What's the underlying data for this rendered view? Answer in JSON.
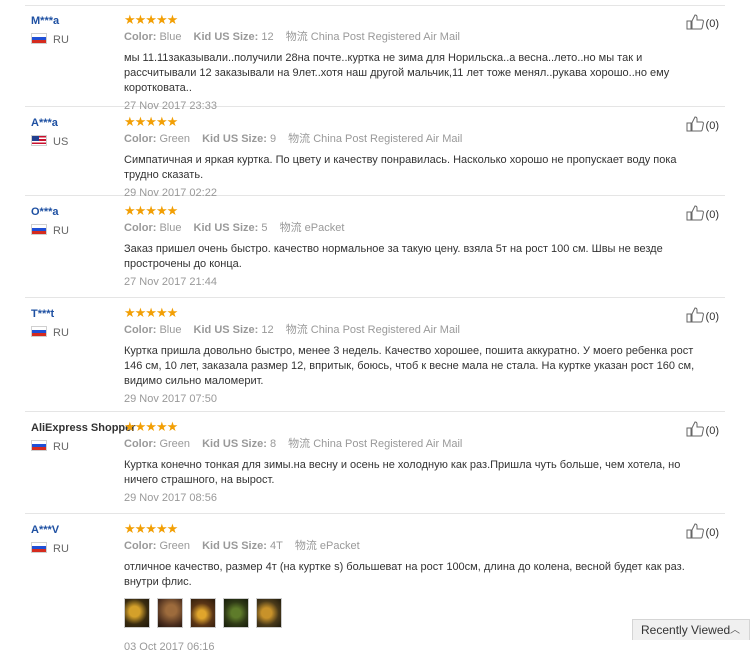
{
  "labels": {
    "color": "Color:",
    "size": "Kid US Size:",
    "helpful_prefix": "(",
    "helpful_suffix": ")"
  },
  "reviews": [
    {
      "user": "M***a",
      "country": "RU",
      "flag": "ru",
      "color": "Blue",
      "size": "12",
      "shipping": "物流 China Post Registered Air Mail",
      "text": "мы 11.11заказывали..получили 28на почте..куртка не зима для Норильска..а весна..лето..но мы так и рассчитывали 12 заказывали на 9лет..хотя наш другой мальчик,11 лет тоже менял..рукава хорошо..но ему коротковата..",
      "date": "27 Nov 2017 23:33",
      "helpful": "0"
    },
    {
      "user": "A***a",
      "country": "US",
      "flag": "us",
      "color": "Green",
      "size": "9",
      "shipping": "物流 China Post Registered Air Mail",
      "text": "Симпатичная и яркая куртка. По цвету и качеству понравилась. Насколько хорошо не пропускает воду пока трудно сказать.",
      "date": "29 Nov 2017 02:22",
      "helpful": "0"
    },
    {
      "user": "O***a",
      "country": "RU",
      "flag": "ru",
      "color": "Blue",
      "size": "5",
      "shipping": "物流 ePacket",
      "text": "Заказ пришел очень быстро. качество нормальное за такую цену. взяла 5т на рост 100 см. Швы не везде прострочены до конца.",
      "date": "27 Nov 2017 21:44",
      "helpful": "0"
    },
    {
      "user": "T***t",
      "country": "RU",
      "flag": "ru",
      "color": "Blue",
      "size": "12",
      "shipping": "物流 China Post Registered Air Mail",
      "text": "Куртка пришла довольно быстро, менее 3 недель. Качество хорошее, пошита аккуратно. У моего ребенка рост 146 см, 10 лет, заказала размер 12, впритык, боюсь, чтоб к весне мала не стала. На куртке указан рост 160 см, видимо сильно маломерит.",
      "date": "29 Nov 2017 07:50",
      "helpful": "0"
    },
    {
      "user": "AliExpress Shopper",
      "country": "RU",
      "flag": "ru",
      "color": "Green",
      "size": "8",
      "shipping": "物流 China Post Registered Air Mail",
      "text": "Куртка конечно тонкая для зимы.на весну и осень не холодную как раз.Пришла чуть больше, чем хотела, но ничего страшного, на вырост.",
      "date": "29 Nov 2017 08:56",
      "helpful": "0"
    },
    {
      "user": "A***V",
      "country": "RU",
      "flag": "ru",
      "color": "Green",
      "size": "4T",
      "shipping": "物流 ePacket",
      "text": "отличное качество, размер 4т (на куртке s) большеват на рост 100см, длина до колена, весной будет как раз. внутри флис.",
      "date": "03 Oct 2017 06:16",
      "helpful": "0"
    }
  ],
  "recently_viewed": {
    "label": "Recently Viewed",
    "icon": "chevron-up-icon"
  }
}
